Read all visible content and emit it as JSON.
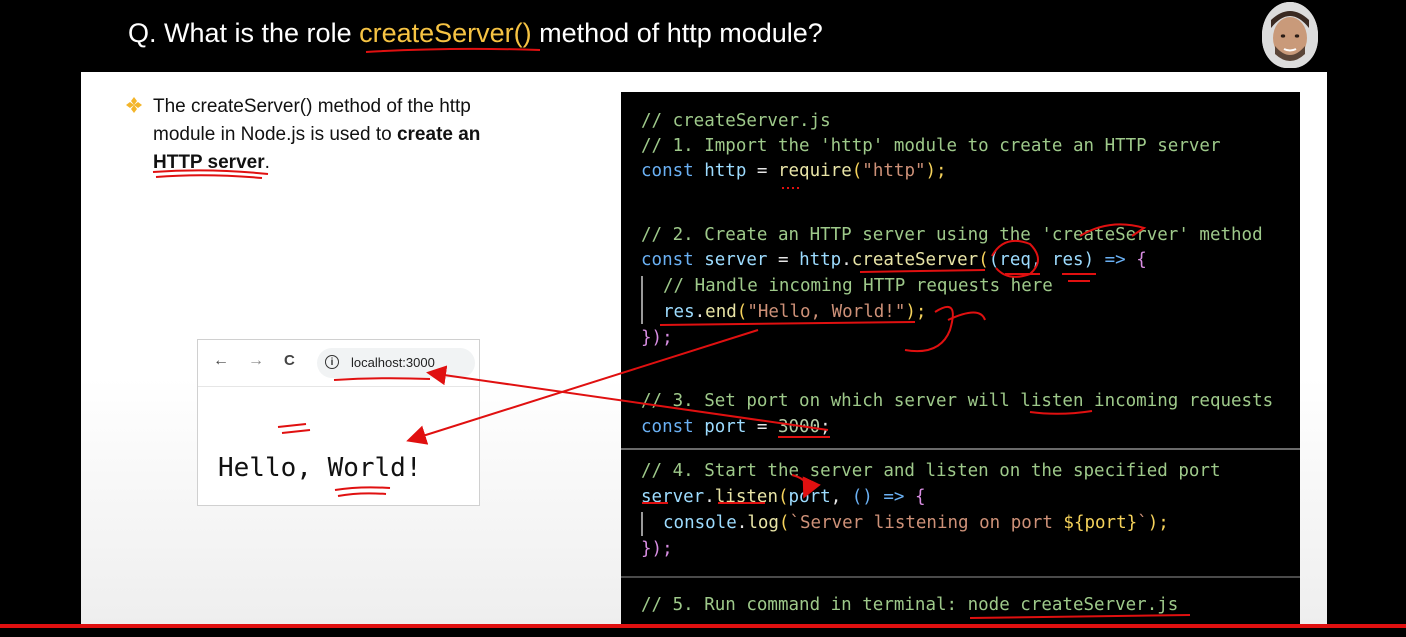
{
  "header": {
    "title_prefix": "Q. What is the role ",
    "title_highlight": "createServer()",
    "title_suffix": " method of http module?"
  },
  "bullet": {
    "text_part1": "The createServer() method of the http module in Node.js is used to ",
    "text_bold": "create an HTTP server",
    "text_end": "."
  },
  "browser": {
    "back": "←",
    "forward": "→",
    "reload": "C",
    "info": "i",
    "url": "localhost:3000",
    "content": "Hello, World!"
  },
  "code": {
    "l1": "// createServer.js",
    "l2": "// 1. Import the 'http' module to create an HTTP server",
    "l3_kw": "const",
    "l3_var": " http",
    "l3_eq": " = ",
    "l3_fn": "require",
    "l3_p1": "(",
    "l3_str": "\"http\"",
    "l3_p2": ");",
    "l4": "// 2. Create an HTTP server using the 'createServer' method",
    "l5_kw": "const",
    "l5_var": " server",
    "l5_eq": " = ",
    "l5_obj": "http",
    "l5_dot": ".",
    "l5_fn": "createServer",
    "l5_p1": "(",
    "l5_args": "(req, res)",
    "l5_arrow": " => ",
    "l5_brace": "{",
    "l6": "// Handle incoming HTTP requests here",
    "l7_obj": "res",
    "l7_dot": ".",
    "l7_fn": "end",
    "l7_p1": "(",
    "l7_str": "\"Hello, World!\"",
    "l7_p2": ");",
    "l8": "});",
    "l9": "// 3. Set port on which server will listen incoming requests",
    "l10_kw": "const",
    "l10_var": " port",
    "l10_eq": " = ",
    "l10_num": "3000",
    "l10_end": ";",
    "l11": "// 4. Start the server and listen on the specified port",
    "l12_obj": "server",
    "l12_dot": ".",
    "l12_fn": "listen",
    "l12_p1": "(",
    "l12_arg": "port",
    "l12_comma": ", ",
    "l12_arrow": "() => ",
    "l12_brace": "{",
    "l13_obj": "console",
    "l13_dot": ".",
    "l13_fn": "log",
    "l13_p1": "(",
    "l13_str": "`Server listening on port ",
    "l13_tpl": "${port}",
    "l13_str2": "`",
    "l13_p2": ");",
    "l14": "});",
    "l15": "// 5. Run command in terminal: node createServer.js"
  },
  "colors": {
    "accent": "#f6c343",
    "annotation": "#e01010",
    "code_bg": "#000000"
  }
}
